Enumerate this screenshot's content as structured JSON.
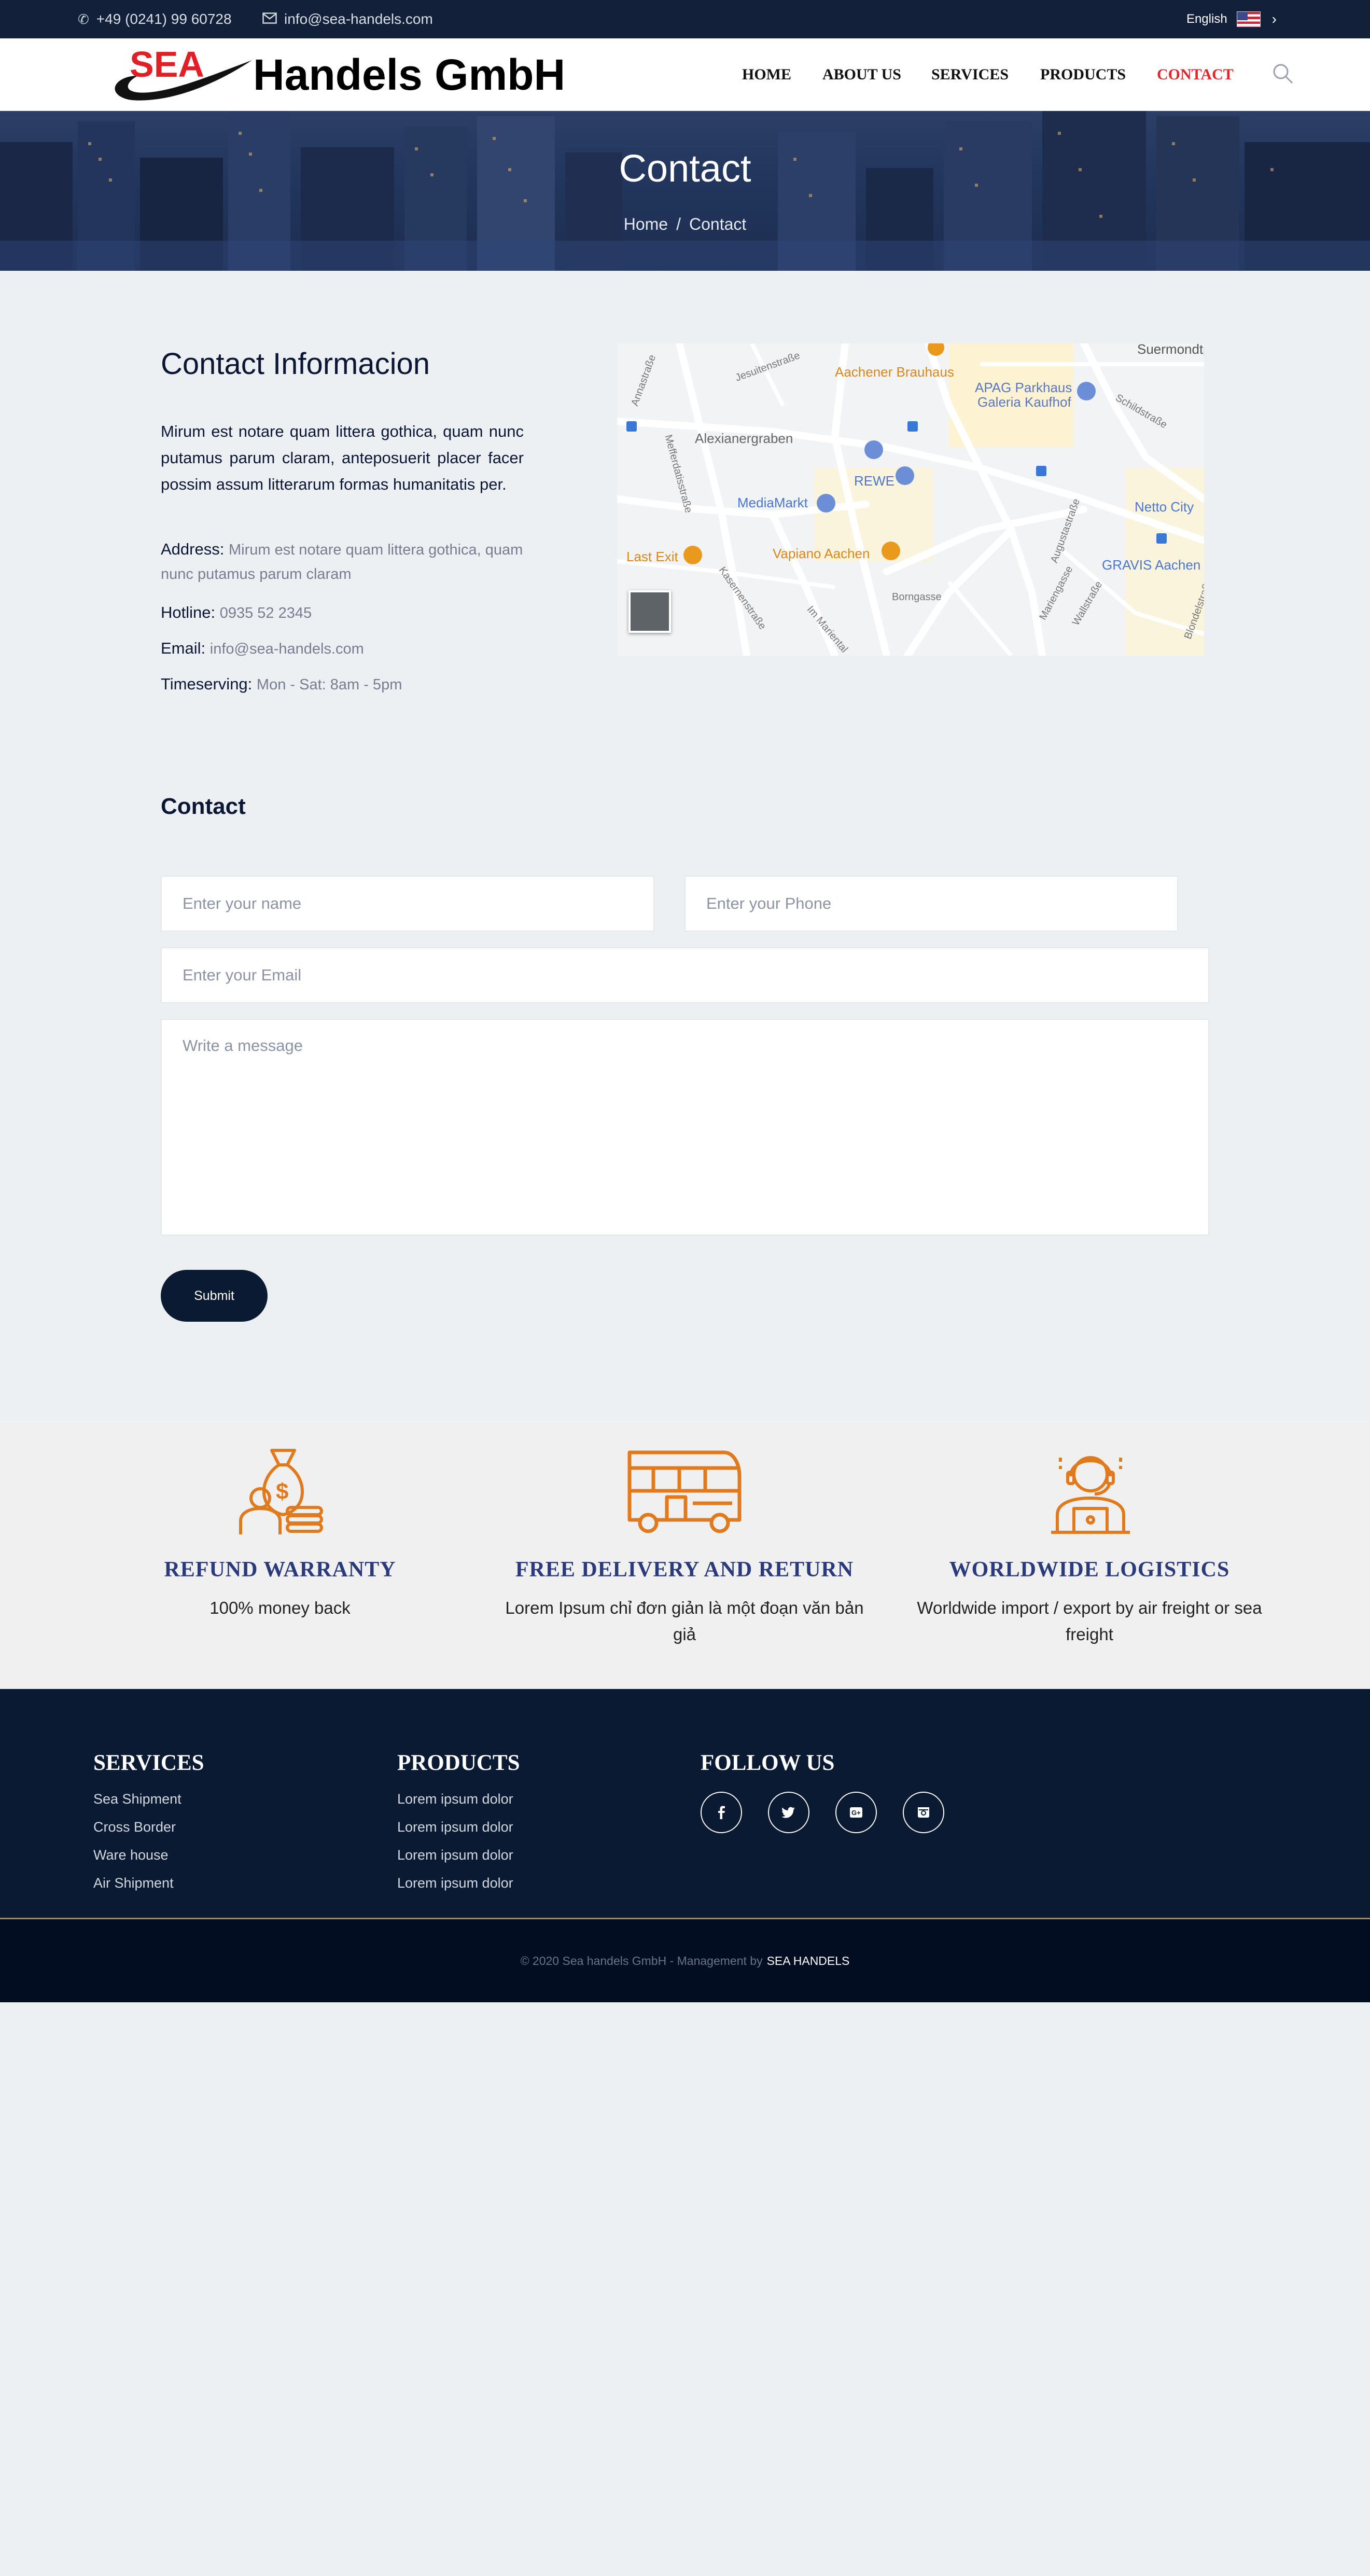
{
  "topbar": {
    "phone": "+49 (0241) 99 60728",
    "email": "info@sea-handels.com",
    "language": "English"
  },
  "header": {
    "logo_sea": "SEA",
    "logo_name": "Handels GmbH",
    "nav": [
      "HOME",
      "ABOUT US",
      "SERVICES",
      "PRODUCTS",
      "CONTACT"
    ],
    "active_nav": "CONTACT"
  },
  "banner": {
    "title": "Contact",
    "crumb_home": "Home",
    "crumb_sep": "/",
    "crumb_current": "Contact"
  },
  "contact_info": {
    "title": "Contact Informacion",
    "description": "Mirum est notare quam littera gothica, quam nunc putamus parum claram, anteposuerit placer facer possim assum litterarum formas humanitatis per.",
    "address_label": "Address:",
    "address_value": "Mirum est notare quam littera gothica, quam nunc putamus parum claram",
    "hotline_label": "Hotline:",
    "hotline_value": "0935 52 2345",
    "email_label": "Email:",
    "email_value": "info@sea-handels.com",
    "time_label": "Timeserving:",
    "time_value": "Mon - Sat: 8am - 5pm"
  },
  "map": {
    "labels": [
      "Suermondtplatz",
      "Aachener Brauhaus",
      "APAG Parkhaus",
      "Galeria Kaufhof",
      "Alexianergraben",
      "REWE",
      "MediaMarkt",
      "Netto City",
      "Vapiano Aachen",
      "GRAVIS Aachen",
      "Last Exit",
      "Borngasse",
      "Kasernenstraße",
      "Im Mariental",
      "Mariengasse",
      "Schildstraße",
      "Annastraße",
      "Jesuitenstraße",
      "Mefferdatisstraße",
      "Augustastraße",
      "Wallstraße",
      "Blondelstraße"
    ]
  },
  "form": {
    "title": "Contact",
    "name_placeholder": "Enter your name",
    "phone_placeholder": "Enter your Phone",
    "email_placeholder": "Enter your Email",
    "message_placeholder": "Write a message",
    "submit_label": "Submit"
  },
  "features": [
    {
      "icon": "money-bag-icon",
      "title": "REFUND WARRANTY",
      "text": "100% money back"
    },
    {
      "icon": "bus-icon",
      "title": "FREE DELIVERY AND RETURN",
      "text": "Lorem Ipsum chỉ đơn giản là một đoạn văn bản giả"
    },
    {
      "icon": "support-agent-icon",
      "title": "WORLDWIDE LOGISTICS",
      "text": "Worldwide import / export by air freight or sea freight"
    }
  ],
  "footer": {
    "services_title": "SERVICES",
    "services": [
      "Sea Shipment",
      "Cross Border",
      "Ware house",
      "Air Shipment"
    ],
    "products_title": "PRODUCTS",
    "products": [
      "Lorem ipsum dolor",
      "Lorem ipsum dolor",
      "Lorem ipsum dolor",
      "Lorem ipsum dolor"
    ],
    "follow_title": "FOLLOW US",
    "social": [
      "facebook-icon",
      "twitter-icon",
      "google-plus-icon",
      "instagram-icon"
    ],
    "copyright": "© 2020 Sea handels GmbH - Management by",
    "copyright_brand": "SEA HANDELS"
  },
  "colors": {
    "navy": "#0b1a33",
    "accent_red": "#e1262c",
    "feature_orange": "#e07a1c",
    "feature_title": "#2a3a7a"
  }
}
